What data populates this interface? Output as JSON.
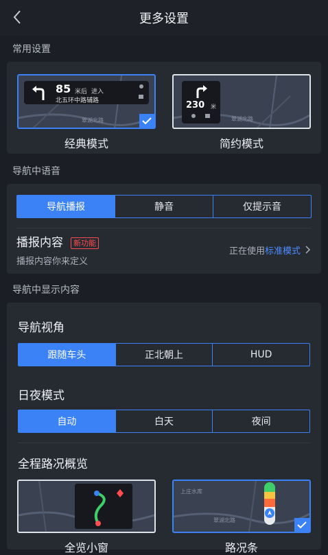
{
  "header": {
    "title": "更多设置"
  },
  "common": {
    "label": "常用设置",
    "classic": {
      "name": "经典模式",
      "distance": "85",
      "distance_unit": "米后",
      "action": "进入",
      "road": "北五环中路辅路"
    },
    "simple": {
      "name": "简约模式",
      "distance": "230",
      "distance_unit": "米"
    },
    "map_road_label": "翠湖北路"
  },
  "voice": {
    "label": "导航中语音",
    "options": [
      "导航播报",
      "静音",
      "仅提示音"
    ],
    "selected": "导航播报",
    "content_title": "播报内容",
    "content_badge": "新功能",
    "content_desc": "播报内容你来定义",
    "using_prefix": "正在使用",
    "using_mode": "标准模式"
  },
  "display": {
    "label": "导航中显示内容",
    "view": {
      "title": "导航视角",
      "options": [
        "跟随车头",
        "正北朝上",
        "HUD"
      ],
      "selected": "跟随车头"
    },
    "daynight": {
      "title": "日夜模式",
      "options": [
        "自动",
        "白天",
        "夜间"
      ],
      "selected": "自动"
    },
    "overview": {
      "title": "全程路况概览",
      "window_name": "全览小窗",
      "bar_name": "路况条",
      "map_label_a": "上庄水库",
      "map_label_b": "翠湖北路",
      "selected": "路况条"
    }
  },
  "colors": {
    "accent": "#3b82f6",
    "badge": "#ff4d4f",
    "bg": "#1b1e24",
    "card": "#262a31"
  }
}
